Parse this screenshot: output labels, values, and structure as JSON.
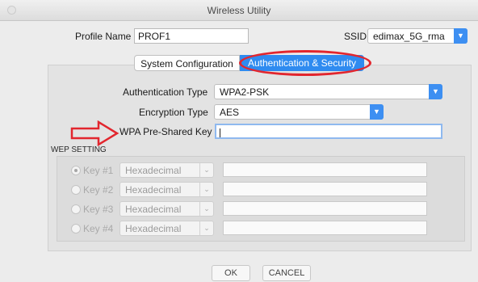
{
  "window": {
    "title": "Wireless Utility"
  },
  "profile": {
    "label": "Profile Name",
    "value": "PROF1"
  },
  "ssid": {
    "label": "SSID",
    "value": "edimax_5G_rma"
  },
  "tabs": [
    {
      "label": "System Configuration",
      "selected": false
    },
    {
      "label": "Authentication & Security",
      "selected": true
    }
  ],
  "auth": {
    "type_label": "Authentication Type",
    "type_value": "WPA2-PSK",
    "enc_label": "Encryption Type",
    "enc_value": "AES",
    "psk_label": "WPA Pre-Shared Key",
    "psk_value": ""
  },
  "wep": {
    "title": "WEP SETTING",
    "keys": [
      {
        "label": "Key #1",
        "format": "Hexadecimal",
        "selected": true
      },
      {
        "label": "Key #2",
        "format": "Hexadecimal",
        "selected": false
      },
      {
        "label": "Key #3",
        "format": "Hexadecimal",
        "selected": false
      },
      {
        "label": "Key #4",
        "format": "Hexadecimal",
        "selected": false
      }
    ]
  },
  "buttons": {
    "ok": "OK",
    "cancel": "CANCEL"
  },
  "colors": {
    "accent": "#2f8bf0",
    "annotation": "#e2262e"
  }
}
